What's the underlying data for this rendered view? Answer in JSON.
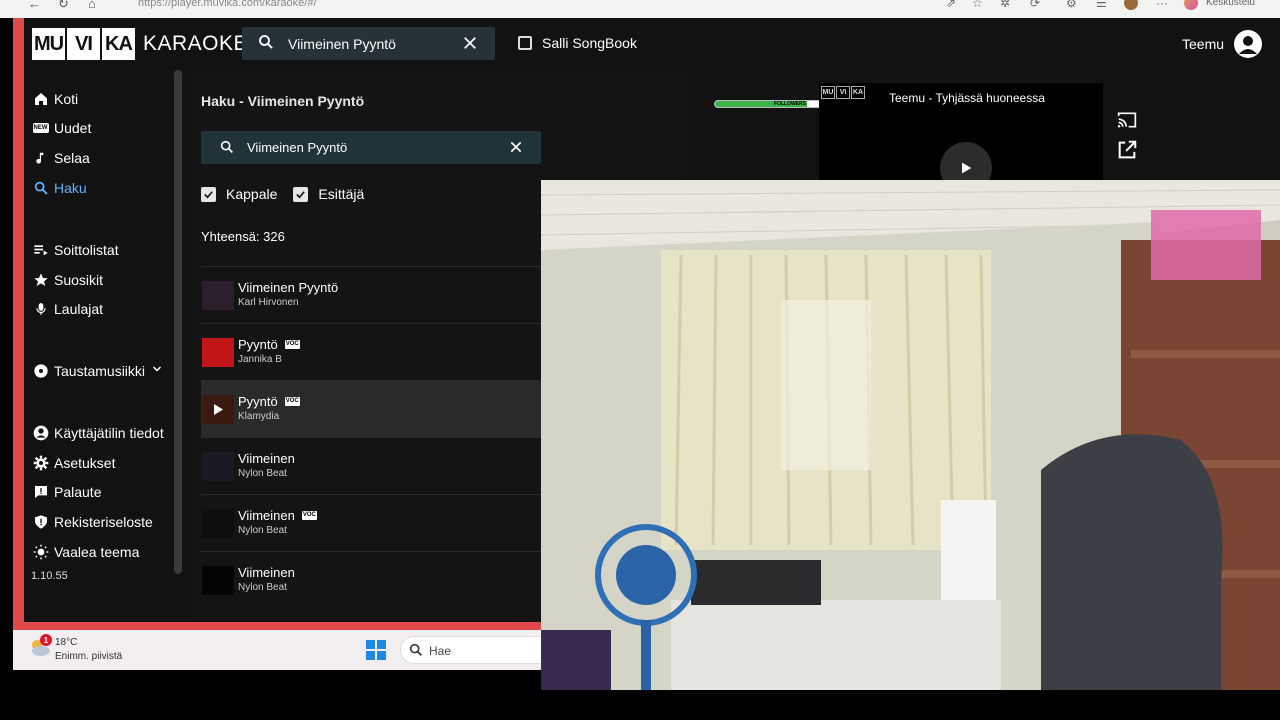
{
  "browser": {
    "url": "https://player.muvika.com/karaoke/#/",
    "profile_label": "Keskustelu"
  },
  "header": {
    "logo_boxes": [
      "MU",
      "VI",
      "KA"
    ],
    "logo_word": "KARAOKE",
    "search_value": "Viimeinen Pyyntö",
    "salli_label": "Salli SongBook",
    "user_name": "Teemu"
  },
  "sidebar": {
    "items": [
      {
        "label": "Koti",
        "icon": "home-icon"
      },
      {
        "label": "Uudet",
        "icon": "new-icon"
      },
      {
        "label": "Selaa",
        "icon": "music-note-icon"
      },
      {
        "label": "Haku",
        "icon": "search-icon"
      },
      {
        "label": "Soittolistat",
        "icon": "playlist-icon"
      },
      {
        "label": "Suosikit",
        "icon": "star-icon"
      },
      {
        "label": "Laulajat",
        "icon": "microphone-icon"
      },
      {
        "label": "Taustamusiikki",
        "icon": "disc-icon"
      },
      {
        "label": "Käyttäjätilin tiedot",
        "icon": "account-icon"
      },
      {
        "label": "Asetukset",
        "icon": "gear-icon"
      },
      {
        "label": "Palaute",
        "icon": "feedback-icon"
      },
      {
        "label": "Rekisteriseloste",
        "icon": "shield-icon"
      },
      {
        "label": "Vaalea teema",
        "icon": "sun-icon"
      }
    ],
    "version": "1.10.55",
    "new_badge": "NEW"
  },
  "search_panel": {
    "title": "Haku - Viimeinen Pyyntö",
    "search_value": "Viimeinen Pyyntö",
    "filters": [
      "Kappale",
      "Esittäjä"
    ],
    "total": "Yhteensä: 326",
    "voc_badge": "VOC",
    "results": [
      {
        "title": "Viimeinen Pyyntö",
        "artist": "Karl Hirvonen",
        "voc": false,
        "thumb_color": "#2a1f2a"
      },
      {
        "title": "Pyyntö",
        "artist": "Jannika B",
        "voc": true,
        "thumb_color": "#c0161a"
      },
      {
        "title": "Pyyntö",
        "artist": "Klamydia",
        "voc": true,
        "thumb_color": "#3a1a10"
      },
      {
        "title": "Viimeinen",
        "artist": "Nylon Beat",
        "voc": false,
        "thumb_color": "#1a1a22"
      },
      {
        "title": "Viimeinen",
        "artist": "Nylon Beat",
        "voc": true,
        "thumb_color": "#0e0e0e"
      },
      {
        "title": "Viimeinen",
        "artist": "Nylon Beat",
        "voc": false,
        "thumb_color": "#050505"
      }
    ]
  },
  "player": {
    "now_playing": "Teemu - Tyhjässä huoneessa",
    "progress_fraction": 0.62,
    "followers_label": "FOLLOWERS",
    "mini_logo": [
      "MU",
      "VI",
      "KA"
    ]
  },
  "taskbar": {
    "badge_count": "1",
    "temperature": "18°C",
    "condition": "Enimm. piivistä",
    "search_label": "Hae"
  }
}
